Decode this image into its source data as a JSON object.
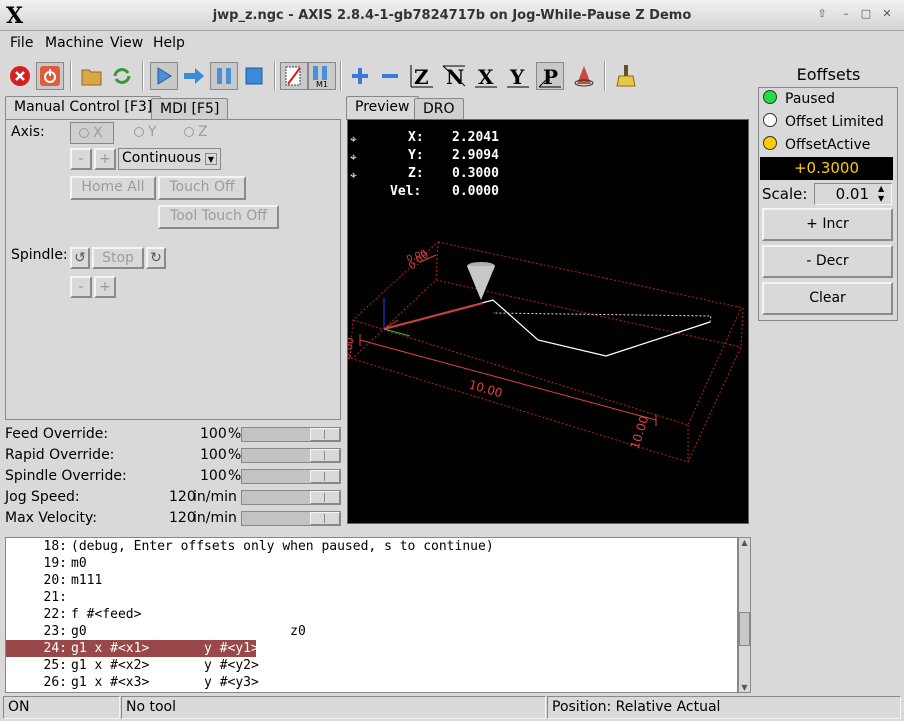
{
  "window": {
    "title": "jwp_z.ngc - AXIS 2.8.4-1-gb7824717b on Jog-While-Pause Z Demo",
    "logo": "X"
  },
  "menubar": {
    "file": "File",
    "machine": "Machine",
    "view": "View",
    "help": "Help"
  },
  "toolbar": {
    "icons": [
      "estop-icon",
      "power-icon",
      "open-icon",
      "reload-icon",
      "run-icon",
      "step-icon",
      "pause-icon",
      "stop-icon",
      "optional-skip-icon",
      "optional-stop-icon",
      "zoom-in-icon",
      "zoom-out-icon",
      "view-z-icon",
      "view-z2-icon",
      "view-x-icon",
      "view-y-icon",
      "view-p-icon",
      "rotate-icon",
      "clear-plot-icon"
    ],
    "m1_label": "M1"
  },
  "manual": {
    "tab_manual": "Manual Control [F3]",
    "tab_mdi": "MDI [F5]",
    "axis_label": "Axis:",
    "axes": [
      "X",
      "Y",
      "Z"
    ],
    "minus": "-",
    "plus": "+",
    "jog_mode": "Continuous",
    "home_all": "Home All",
    "touch_off": "Touch Off",
    "tool_touch_off": "Tool Touch Off",
    "spindle_label": "Spindle:",
    "stop": "Stop"
  },
  "overrides": [
    {
      "label": "Feed Override:",
      "value": "100",
      "unit": "%"
    },
    {
      "label": "Rapid Override:",
      "value": "100",
      "unit": "%"
    },
    {
      "label": "Spindle Override:",
      "value": "100",
      "unit": "%"
    },
    {
      "label": "Jog Speed:",
      "value": "120",
      "unit": "in/min"
    },
    {
      "label": "Max Velocity:",
      "value": "120",
      "unit": "in/min"
    }
  ],
  "preview": {
    "tab_preview": "Preview",
    "tab_dro": "DRO",
    "dro": [
      {
        "axis": "X:",
        "value": "2.2041"
      },
      {
        "axis": "Y:",
        "value": "2.9094"
      },
      {
        "axis": "Z:",
        "value": "0.3000"
      },
      {
        "axis": "Vel:",
        "value": "0.0000"
      }
    ],
    "dim_labels": [
      "10.00",
      "10.00",
      "0.00",
      "0.00",
      "0.00"
    ]
  },
  "code": [
    {
      "num": "18:",
      "text": "(debug, Enter offsets only when paused, s to continue)"
    },
    {
      "num": "19:",
      "text": "m0"
    },
    {
      "num": "20:",
      "text": "m111"
    },
    {
      "num": "21:",
      "text": ""
    },
    {
      "num": "22:",
      "text": "f #<feed>"
    },
    {
      "num": "23:",
      "text": "g0                          z0"
    },
    {
      "num": "24:",
      "text": "g1 x #<x1>       y #<y1>"
    },
    {
      "num": "25:",
      "text": "g1 x #<x2>       y #<y2>"
    },
    {
      "num": "26:",
      "text": "g1 x #<x3>       y #<y3>"
    }
  ],
  "selected_line": "24:",
  "status": {
    "state": "ON",
    "tool": "No tool",
    "position": "Position: Relative Actual"
  },
  "eoffsets": {
    "title": "Eoffsets",
    "paused": "Paused",
    "limited": "Offset Limited",
    "active": "OffsetActive",
    "value": "+0.3000",
    "scale_label": "Scale:",
    "scale_value": "0.01",
    "incr": "+ Incr",
    "decr": "- Decr",
    "clear": "Clear"
  },
  "colors": {
    "paused_led": "#22dd44",
    "active_led": "#ffcc00",
    "offset_value": "#ffcc00",
    "selected_row": "#984848"
  }
}
